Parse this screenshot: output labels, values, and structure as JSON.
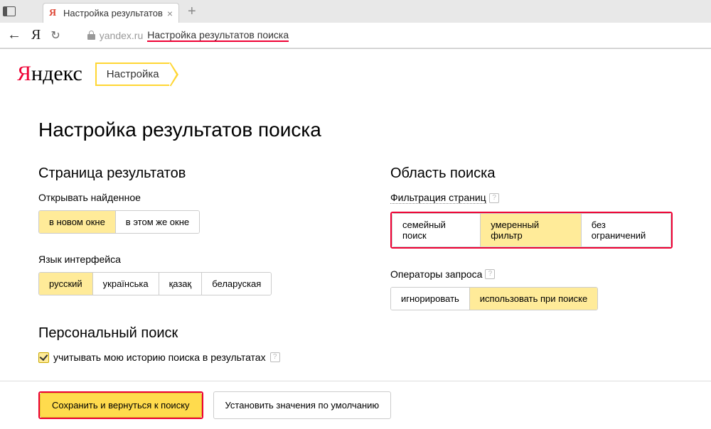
{
  "browser": {
    "tab_title": "Настройка результатов",
    "url_host": "yandex.ru",
    "url_page": "Настройка результатов поиска"
  },
  "header": {
    "logo_red": "Я",
    "logo_rest": "ндекс",
    "active_tab": "Настройка"
  },
  "page": {
    "title": "Настройка результатов поиска",
    "left": {
      "heading": "Страница результатов",
      "open_found": {
        "label": "Открывать найденное",
        "options": [
          "в новом окне",
          "в этом же окне"
        ],
        "active": 0
      },
      "ui_lang": {
        "label": "Язык интерфейса",
        "options": [
          "русский",
          "українська",
          "қазақ",
          "беларуская"
        ],
        "active": 0
      },
      "personal": {
        "heading": "Персональный поиск",
        "checkbox_label": "учитывать мою историю поиска в результатах"
      }
    },
    "right": {
      "heading": "Область поиска",
      "filter": {
        "label": "Фильтрация страниц",
        "options": [
          "семейный поиск",
          "умеренный фильтр",
          "без ограничений"
        ],
        "active": 1
      },
      "operators": {
        "label": "Операторы запроса",
        "options": [
          "игнорировать",
          "использовать при поиске"
        ],
        "active": 1
      }
    }
  },
  "footer": {
    "save": "Сохранить и вернуться к поиску",
    "reset": "Установить значения по умолчанию"
  }
}
